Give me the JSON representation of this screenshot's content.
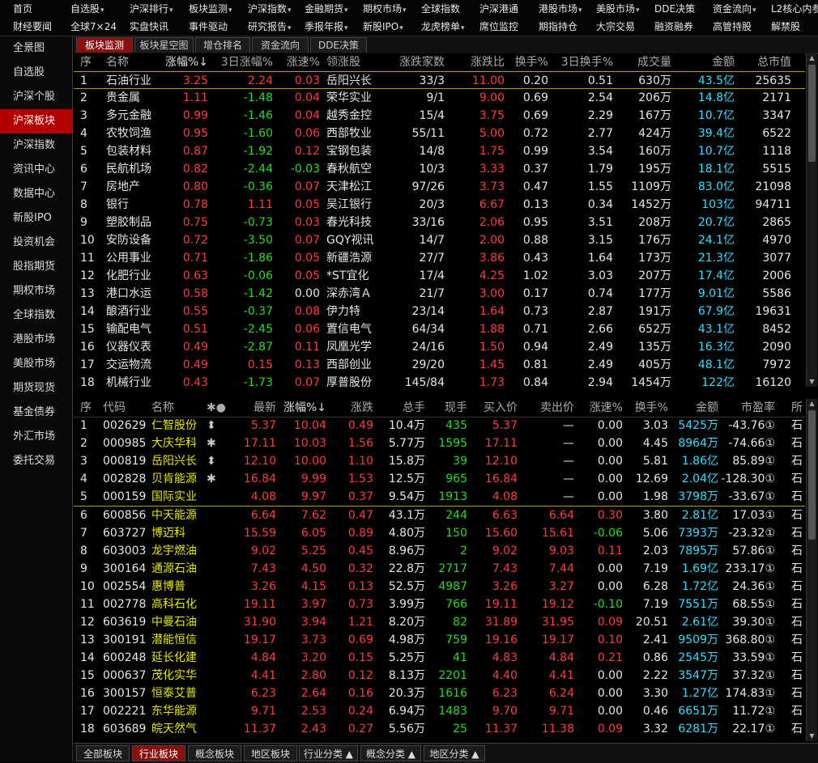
{
  "nav_row1": [
    {
      "label": "首页",
      "caret": false
    },
    {
      "label": "自选股",
      "caret": true
    },
    {
      "label": "沪深排行",
      "caret": true
    },
    {
      "label": "板块监测",
      "caret": true
    },
    {
      "label": "沪深指数",
      "caret": true
    },
    {
      "label": "金融期货",
      "caret": true
    },
    {
      "label": "期权市场",
      "caret": true
    },
    {
      "label": "全球指数",
      "caret": false
    },
    {
      "label": "沪深港通",
      "caret": false
    },
    {
      "label": "港股市场",
      "caret": true
    },
    {
      "label": "美股市场",
      "caret": true
    },
    {
      "label": "DDE决策",
      "caret": false
    },
    {
      "label": "资金流向",
      "caret": true
    },
    {
      "label": "L2核心内参",
      "caret": false
    }
  ],
  "nav_row2": [
    {
      "label": "财经要闻",
      "caret": false
    },
    {
      "label": "全球7×24",
      "caret": false
    },
    {
      "label": "实盘快讯",
      "caret": false
    },
    {
      "label": "事件驱动",
      "caret": false
    },
    {
      "label": "研究报告",
      "caret": true
    },
    {
      "label": "季报年报",
      "caret": true
    },
    {
      "label": "新股IPO",
      "caret": true
    },
    {
      "label": "龙虎榜单",
      "caret": true
    },
    {
      "label": "席位监控",
      "caret": false
    },
    {
      "label": "期指持仓",
      "caret": false
    },
    {
      "label": "大宗交易",
      "caret": false
    },
    {
      "label": "融资融券",
      "caret": false
    },
    {
      "label": "高管持股",
      "caret": false
    },
    {
      "label": "解禁股",
      "caret": false
    }
  ],
  "sidebar": [
    "全景图",
    "自选股",
    "沪深个股",
    "沪深板块",
    "沪深指数",
    "资讯中心",
    "数据中心",
    "新股IPO",
    "投资机会",
    "股指期货",
    "期权市场",
    "全球指数",
    "港股市场",
    "美股市场",
    "期货现货",
    "基金债券",
    "外汇市场",
    "委托交易"
  ],
  "sidebar_active": 3,
  "top_tabs": [
    "板块监测",
    "板块星空图",
    "增仓排名",
    "资金流向",
    "DDE决策"
  ],
  "top_tabs_active": 0,
  "sector_table": {
    "headers": [
      "序",
      "名称",
      "涨幅%↓",
      "3日涨幅%",
      "涨速%",
      "领涨股",
      "涨跌家数",
      "涨跌比",
      "换手%",
      "3日换手%",
      "成交量",
      "金额",
      "总市值"
    ],
    "rows": [
      [
        "1",
        "石油行业",
        "3.25",
        "2.24",
        "0.03",
        "岳阳兴长",
        "33/3",
        "11.00",
        "0.20",
        "0.51",
        "630万",
        "43.5亿",
        "25635"
      ],
      [
        "2",
        "贵金属",
        "1.11",
        "-1.48",
        "0.04",
        "荣华实业",
        "9/1",
        "9.00",
        "0.69",
        "2.54",
        "206万",
        "14.8亿",
        "2171"
      ],
      [
        "3",
        "多元金融",
        "0.99",
        "-1.46",
        "0.04",
        "越秀金控",
        "15/4",
        "3.75",
        "0.69",
        "2.29",
        "167万",
        "10.7亿",
        "3347"
      ],
      [
        "4",
        "农牧饲渔",
        "0.95",
        "-1.60",
        "0.06",
        "西部牧业",
        "55/11",
        "5.00",
        "0.72",
        "2.77",
        "424万",
        "39.4亿",
        "6522"
      ],
      [
        "5",
        "包装材料",
        "0.87",
        "-1.92",
        "0.12",
        "宝钢包装",
        "14/8",
        "1.75",
        "0.99",
        "3.54",
        "160万",
        "10.7亿",
        "1118"
      ],
      [
        "6",
        "民航机场",
        "0.82",
        "-2.44",
        "-0.03",
        "春秋航空",
        "10/3",
        "3.33",
        "0.37",
        "1.79",
        "195万",
        "18.1亿",
        "5515"
      ],
      [
        "7",
        "房地产",
        "0.80",
        "-0.36",
        "0.07",
        "天津松江",
        "97/26",
        "3.73",
        "0.47",
        "1.55",
        "1109万",
        "83.0亿",
        "21098"
      ],
      [
        "8",
        "银行",
        "0.78",
        "1.11",
        "0.05",
        "吴江银行",
        "20/3",
        "6.67",
        "0.13",
        "0.34",
        "1452万",
        "103亿",
        "94711"
      ],
      [
        "9",
        "塑胶制品",
        "0.75",
        "-0.73",
        "0.03",
        "春光科技",
        "33/16",
        "2.06",
        "0.95",
        "3.51",
        "208万",
        "20.7亿",
        "2865"
      ],
      [
        "10",
        "安防设备",
        "0.72",
        "-3.50",
        "0.07",
        "GQY视讯",
        "14/7",
        "2.00",
        "0.88",
        "3.15",
        "176万",
        "24.1亿",
        "4970"
      ],
      [
        "11",
        "公用事业",
        "0.71",
        "-1.86",
        "0.05",
        "新疆浩源",
        "27/7",
        "3.86",
        "0.43",
        "1.64",
        "173万",
        "21.3亿",
        "3077"
      ],
      [
        "12",
        "化肥行业",
        "0.63",
        "-0.06",
        "0.05",
        "*ST宜化",
        "17/4",
        "4.25",
        "1.02",
        "3.03",
        "207万",
        "17.4亿",
        "2006"
      ],
      [
        "13",
        "港口水运",
        "0.58",
        "-1.42",
        "0.00",
        "深赤湾Ａ",
        "21/7",
        "3.00",
        "0.17",
        "0.74",
        "177万",
        "9.01亿",
        "5586"
      ],
      [
        "14",
        "酿酒行业",
        "0.55",
        "-0.37",
        "0.08",
        "伊力特",
        "23/14",
        "1.64",
        "0.73",
        "2.87",
        "191万",
        "67.9亿",
        "19631"
      ],
      [
        "15",
        "输配电气",
        "0.51",
        "-2.45",
        "0.06",
        "置信电气",
        "64/34",
        "1.88",
        "0.71",
        "2.66",
        "652万",
        "43.1亿",
        "8452"
      ],
      [
        "16",
        "仪器仪表",
        "0.49",
        "-2.87",
        "0.11",
        "凤凰光学",
        "24/16",
        "1.50",
        "0.94",
        "2.49",
        "135万",
        "16.3亿",
        "2090"
      ],
      [
        "17",
        "交运物流",
        "0.49",
        "0.15",
        "0.13",
        "西部创业",
        "29/20",
        "1.45",
        "0.81",
        "2.49",
        "405万",
        "48.1亿",
        "7972"
      ],
      [
        "18",
        "机械行业",
        "0.43",
        "-1.73",
        "0.07",
        "厚普股份",
        "145/84",
        "1.73",
        "0.84",
        "2.94",
        "1454万",
        "122亿",
        "16120"
      ]
    ]
  },
  "stock_table": {
    "headers": [
      "序",
      "代码",
      "名称",
      "✱●",
      "最新",
      "涨幅%↓",
      "涨跌",
      "总手",
      "现手",
      "买入价",
      "卖出价",
      "涨速%",
      "换手%",
      "金额",
      "市盈率",
      "所"
    ],
    "rows": [
      [
        "1",
        "002629",
        "仁智股份",
        "⬍",
        "5.37",
        "10.04",
        "0.49",
        "10.4万",
        "435",
        "5.37",
        "—",
        "0.00",
        "3.03",
        "5425万",
        "-43.76①",
        "石"
      ],
      [
        "2",
        "000985",
        "大庆华科",
        "✱",
        "17.11",
        "10.03",
        "1.56",
        "5.77万",
        "1595",
        "17.11",
        "—",
        "0.00",
        "4.45",
        "8964万",
        "-74.66①",
        "石"
      ],
      [
        "3",
        "000819",
        "岳阳兴长",
        "⬍",
        "12.10",
        "10.00",
        "1.10",
        "15.8万",
        "39",
        "12.10",
        "—",
        "0.00",
        "5.81",
        "1.86亿",
        "85.89①",
        "石"
      ],
      [
        "4",
        "002828",
        "贝肯能源",
        "✱",
        "16.84",
        "9.99",
        "1.53",
        "12.5万",
        "965",
        "16.84",
        "—",
        "0.00",
        "12.69",
        "2.04亿",
        "-128.30①",
        "石"
      ],
      [
        "5",
        "000159",
        "国际实业",
        "",
        "4.08",
        "9.97",
        "0.37",
        "9.54万",
        "1913",
        "4.08",
        "—",
        "0.00",
        "1.98",
        "3798万",
        "-33.67①",
        "石"
      ],
      [
        "6",
        "600856",
        "中天能源",
        "",
        "6.64",
        "7.62",
        "0.47",
        "43.1万",
        "244",
        "6.63",
        "6.64",
        "0.30",
        "3.80",
        "2.81亿",
        "17.03①",
        "石"
      ],
      [
        "7",
        "603727",
        "博迈科",
        "",
        "15.59",
        "6.05",
        "0.89",
        "4.80万",
        "150",
        "15.60",
        "15.61",
        "-0.06",
        "5.06",
        "7393万",
        "-23.32①",
        "石"
      ],
      [
        "8",
        "603003",
        "龙宇燃油",
        "",
        "9.02",
        "5.25",
        "0.45",
        "8.96万",
        "2",
        "9.02",
        "9.03",
        "0.11",
        "2.03",
        "7895万",
        "57.86①",
        "石"
      ],
      [
        "9",
        "300164",
        "通源石油",
        "",
        "7.43",
        "4.50",
        "0.32",
        "22.8万",
        "2717",
        "7.43",
        "7.44",
        "0.00",
        "7.19",
        "1.69亿",
        "233.17①",
        "石"
      ],
      [
        "10",
        "002554",
        "惠博普",
        "",
        "3.26",
        "4.15",
        "0.13",
        "52.5万",
        "4987",
        "3.26",
        "3.27",
        "0.00",
        "6.28",
        "1.72亿",
        "24.36①",
        "石"
      ],
      [
        "11",
        "002778",
        "高科石化",
        "",
        "19.11",
        "3.97",
        "0.73",
        "3.99万",
        "766",
        "19.11",
        "19.12",
        "-0.10",
        "7.19",
        "7551万",
        "68.55①",
        "石"
      ],
      [
        "12",
        "603619",
        "中曼石油",
        "",
        "31.90",
        "3.94",
        "1.21",
        "8.20万",
        "82",
        "31.89",
        "31.95",
        "0.09",
        "20.51",
        "2.61亿",
        "39.30①",
        "石"
      ],
      [
        "13",
        "300191",
        "潜能恒信",
        "",
        "19.17",
        "3.73",
        "0.69",
        "4.98万",
        "759",
        "19.16",
        "19.17",
        "0.10",
        "2.41",
        "9509万",
        "368.80①",
        "石"
      ],
      [
        "14",
        "600248",
        "延长化建",
        "",
        "4.84",
        "3.20",
        "0.15",
        "5.25万",
        "41",
        "4.83",
        "4.84",
        "0.21",
        "0.86",
        "2545万",
        "33.59①",
        "石"
      ],
      [
        "15",
        "000637",
        "茂化实华",
        "",
        "4.41",
        "2.80",
        "0.12",
        "8.13万",
        "2201",
        "4.40",
        "4.41",
        "0.00",
        "2.22",
        "3547万",
        "37.32①",
        "石"
      ],
      [
        "16",
        "300157",
        "恒泰艾普",
        "",
        "6.23",
        "2.64",
        "0.16",
        "20.3万",
        "1616",
        "6.23",
        "6.24",
        "0.00",
        "3.30",
        "1.27亿",
        "174.83①",
        "石"
      ],
      [
        "17",
        "002221",
        "东华能源",
        "",
        "9.71",
        "2.53",
        "0.24",
        "6.94万",
        "1483",
        "9.70",
        "9.71",
        "0.00",
        "0.46",
        "6651万",
        "11.72①",
        "石"
      ],
      [
        "18",
        "603689",
        "皖天然气",
        "",
        "11.37",
        "2.43",
        "0.27",
        "5.56万",
        "25",
        "11.37",
        "11.38",
        "0.09",
        "3.32",
        "6281万",
        "22.17①",
        "石"
      ]
    ]
  },
  "bottom_tabs": [
    "全部板块",
    "行业板块",
    "概念板块",
    "地区板块",
    "行业分类 ▲",
    "概念分类 ▲",
    "地区分类 ▲"
  ],
  "bottom_tabs_active": 1
}
